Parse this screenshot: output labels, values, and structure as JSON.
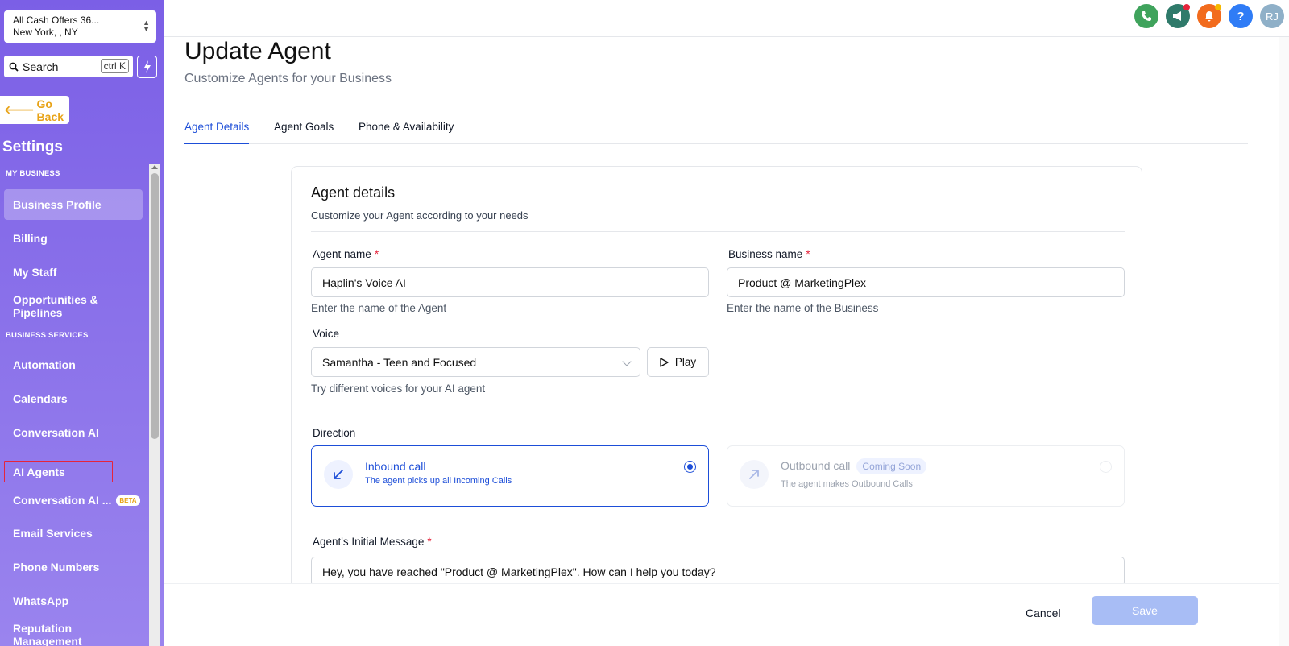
{
  "sidebar": {
    "location": {
      "name": "All Cash Offers 36...",
      "city": "New York, , NY"
    },
    "search": {
      "placeholder": "Search",
      "shortcut": "ctrl K"
    },
    "go_back": "Go Back",
    "title": "Settings",
    "sections": {
      "my_business": "MY BUSINESS",
      "business_services": "BUSINESS SERVICES"
    },
    "items": [
      {
        "label": "Business Profile"
      },
      {
        "label": "Billing"
      },
      {
        "label": "My Staff"
      },
      {
        "label": "Opportunities & Pipelines"
      },
      {
        "label": "Automation"
      },
      {
        "label": "Calendars"
      },
      {
        "label": "Conversation AI"
      },
      {
        "label": "AI Agents"
      },
      {
        "label": "Conversation AI ...",
        "badge": "BETA"
      },
      {
        "label": "Email Services"
      },
      {
        "label": "Phone Numbers"
      },
      {
        "label": "WhatsApp"
      },
      {
        "label": "Reputation Management"
      }
    ]
  },
  "topbar": {
    "icons": [
      "phone-icon",
      "megaphone-icon",
      "bell-icon",
      "help-icon"
    ],
    "colors": {
      "phone": "#3fa35c",
      "megaphone": "#2f7a6a",
      "bell": "#f26b1d",
      "help": "#2f7cf6",
      "avatar": "#8fb0c8"
    },
    "help_glyph": "?",
    "avatar_initials": "RJ"
  },
  "page": {
    "title": "Update Agent",
    "subtitle": "Customize Agents for your Business",
    "tabs": [
      {
        "label": "Agent Details"
      },
      {
        "label": "Agent Goals"
      },
      {
        "label": "Phone & Availability"
      }
    ]
  },
  "card": {
    "title": "Agent details",
    "subtitle": "Customize your Agent according to your needs",
    "agent_name": {
      "label": "Agent name",
      "required": "*",
      "value": "Haplin's Voice AI",
      "hint": "Enter the name of the Agent"
    },
    "business_name": {
      "label": "Business name",
      "required": "*",
      "value": "Product @ MarketingPlex",
      "hint": "Enter the name of the Business"
    },
    "voice": {
      "label": "Voice",
      "value": "Samantha - Teen and Focused",
      "play_label": "Play",
      "hint": "Try different voices for your AI agent"
    },
    "direction": {
      "label": "Direction",
      "inbound": {
        "title": "Inbound call",
        "desc": "The agent picks up all Incoming Calls",
        "selected": true
      },
      "outbound": {
        "title": "Outbound call",
        "badge": "Coming Soon",
        "desc": "The agent makes Outbound Calls",
        "selected": false
      }
    },
    "initial_message": {
      "label": "Agent's Initial Message",
      "required": "*",
      "value": "Hey, you have reached \"Product @ MarketingPlex\". How can I help you today?"
    }
  },
  "footer": {
    "cancel": "Cancel",
    "save": "Save"
  },
  "accent": "#1d4ed8"
}
